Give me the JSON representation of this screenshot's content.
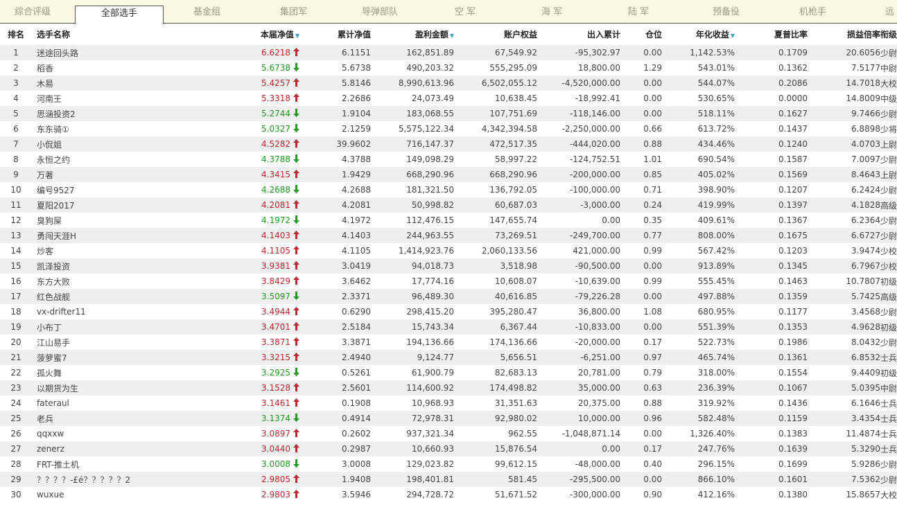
{
  "tabs": [
    {
      "label": "综合评级",
      "active": false
    },
    {
      "label": "全部选手",
      "active": true
    },
    {
      "label": "基金组",
      "active": false
    },
    {
      "label": "集团军",
      "active": false
    },
    {
      "label": "导弹部队",
      "active": false
    },
    {
      "label": "空  军",
      "active": false
    },
    {
      "label": "海  军",
      "active": false
    },
    {
      "label": "陆  军",
      "active": false
    },
    {
      "label": "预备役",
      "active": false
    },
    {
      "label": "机枪手",
      "active": false
    },
    {
      "label": "远",
      "active": false
    }
  ],
  "columns": [
    "排名",
    "选手名称",
    "本届净值",
    "累计净值",
    "盈利金额",
    "账户权益",
    "出入累计",
    "仓位",
    "年化收益",
    "夏普比率",
    "损益倍率",
    "衔级"
  ],
  "sort_icon": "▼",
  "colors": {
    "up": "#c0272d",
    "down": "#1e9a1e",
    "sort": "#3aa0c8"
  },
  "rows": [
    {
      "rank": "1",
      "name": "迷途回头路",
      "nav": "6.6218",
      "dir": "up",
      "cum": "6.1151",
      "profit": "162,851.89",
      "equity": "67,549.92",
      "flow": "-95,302.97",
      "pos": "0.00",
      "annual": "1,142.53%",
      "sharpe": "0.1709",
      "ratio": "20.6056",
      "grade": "少尉"
    },
    {
      "rank": "2",
      "name": "稻香",
      "nav": "5.6738",
      "dir": "down",
      "cum": "5.6738",
      "profit": "490,203.32",
      "equity": "555,295.09",
      "flow": "18,800.00",
      "pos": "1.29",
      "annual": "543.01%",
      "sharpe": "0.1362",
      "ratio": "7.5177",
      "grade": "中尉"
    },
    {
      "rank": "3",
      "name": "木易",
      "nav": "5.4257",
      "dir": "up",
      "cum": "5.8146",
      "profit": "8,990,613.96",
      "equity": "6,502,055.12",
      "flow": "-4,520,000.00",
      "pos": "0.00",
      "annual": "544.07%",
      "sharpe": "0.2086",
      "ratio": "14.7018",
      "grade": "大校"
    },
    {
      "rank": "4",
      "name": "河南王",
      "nav": "5.3318",
      "dir": "up",
      "cum": "2.2686",
      "profit": "24,073.49",
      "equity": "10,638.45",
      "flow": "-18,992.41",
      "pos": "0.00",
      "annual": "530.65%",
      "sharpe": "0.0000",
      "ratio": "14.8009",
      "grade": "中级士官"
    },
    {
      "rank": "5",
      "name": "思涵投资2",
      "nav": "5.2744",
      "dir": "down",
      "cum": "1.9104",
      "profit": "183,068.55",
      "equity": "107,751.69",
      "flow": "-118,146.00",
      "pos": "0.00",
      "annual": "518.11%",
      "sharpe": "0.1627",
      "ratio": "9.7466",
      "grade": "少尉"
    },
    {
      "rank": "6",
      "name": "东东骑①",
      "nav": "5.0327",
      "dir": "down",
      "cum": "2.1259",
      "profit": "5,575,122.34",
      "equity": "4,342,394.58",
      "flow": "-2,250,000.00",
      "pos": "0.66",
      "annual": "613.72%",
      "sharpe": "0.1437",
      "ratio": "6.8898",
      "grade": "少将"
    },
    {
      "rank": "7",
      "name": "小侃姐",
      "nav": "4.5282",
      "dir": "up",
      "cum": "39.9602",
      "profit": "716,147.37",
      "equity": "472,517.35",
      "flow": "-444,020.00",
      "pos": "0.88",
      "annual": "434.46%",
      "sharpe": "0.1240",
      "ratio": "4.0703",
      "grade": "上尉"
    },
    {
      "rank": "8",
      "name": "永恒之约",
      "nav": "4.3788",
      "dir": "down",
      "cum": "4.3788",
      "profit": "149,098.29",
      "equity": "58,997.22",
      "flow": "-124,752.51",
      "pos": "1.01",
      "annual": "690.54%",
      "sharpe": "0.1587",
      "ratio": "7.0097",
      "grade": "少尉"
    },
    {
      "rank": "9",
      "name": "万著",
      "nav": "4.3415",
      "dir": "up",
      "cum": "1.9429",
      "profit": "668,290.96",
      "equity": "668,290.96",
      "flow": "-200,000.00",
      "pos": "0.85",
      "annual": "405.02%",
      "sharpe": "0.1569",
      "ratio": "8.4643",
      "grade": "上尉"
    },
    {
      "rank": "10",
      "name": "编号9527",
      "nav": "4.2688",
      "dir": "down",
      "cum": "4.2688",
      "profit": "181,321.50",
      "equity": "136,792.05",
      "flow": "-100,000.00",
      "pos": "0.71",
      "annual": "398.90%",
      "sharpe": "0.1207",
      "ratio": "6.2424",
      "grade": "少尉"
    },
    {
      "rank": "11",
      "name": "夏阳2017",
      "nav": "4.2081",
      "dir": "up",
      "cum": "4.2081",
      "profit": "50,998.82",
      "equity": "60,687.03",
      "flow": "-3,000.00",
      "pos": "0.24",
      "annual": "419.99%",
      "sharpe": "0.1397",
      "ratio": "4.1828",
      "grade": "高级士官"
    },
    {
      "rank": "12",
      "name": "臭狗屎",
      "nav": "4.1972",
      "dir": "down",
      "cum": "4.1972",
      "profit": "112,476.15",
      "equity": "147,655.74",
      "flow": "0.00",
      "pos": "0.35",
      "annual": "409.61%",
      "sharpe": "0.1367",
      "ratio": "6.2364",
      "grade": "少尉"
    },
    {
      "rank": "13",
      "name": "勇闯天涯H",
      "nav": "4.1403",
      "dir": "up",
      "cum": "4.1403",
      "profit": "244,963.55",
      "equity": "73,269.51",
      "flow": "-249,700.00",
      "pos": "0.77",
      "annual": "808.00%",
      "sharpe": "0.1675",
      "ratio": "6.6727",
      "grade": "少尉"
    },
    {
      "rank": "14",
      "name": "炒客",
      "nav": "4.1105",
      "dir": "up",
      "cum": "4.1105",
      "profit": "1,414,923.76",
      "equity": "2,060,133.56",
      "flow": "421,000.00",
      "pos": "0.99",
      "annual": "567.42%",
      "sharpe": "0.1203",
      "ratio": "3.9474",
      "grade": "少校"
    },
    {
      "rank": "15",
      "name": "凯泽投资",
      "nav": "3.9381",
      "dir": "up",
      "cum": "3.0419",
      "profit": "94,018.73",
      "equity": "3,518.98",
      "flow": "-90,500.00",
      "pos": "0.00",
      "annual": "913.89%",
      "sharpe": "0.1345",
      "ratio": "6.7967",
      "grade": "少校"
    },
    {
      "rank": "16",
      "name": "东方大败",
      "nav": "3.8429",
      "dir": "up",
      "cum": "3.6462",
      "profit": "17,774.16",
      "equity": "10,608.07",
      "flow": "-10,639.00",
      "pos": "0.99",
      "annual": "555.45%",
      "sharpe": "0.1463",
      "ratio": "10.7807",
      "grade": "初级士官"
    },
    {
      "rank": "17",
      "name": "红色战舰",
      "nav": "3.5097",
      "dir": "down",
      "cum": "2.3371",
      "profit": "96,489.30",
      "equity": "40,616.85",
      "flow": "-79,226.28",
      "pos": "0.00",
      "annual": "497.88%",
      "sharpe": "0.1359",
      "ratio": "5.7425",
      "grade": "高级士官"
    },
    {
      "rank": "18",
      "name": "vx-drifter11",
      "nav": "3.4944",
      "dir": "up",
      "cum": "0.6290",
      "profit": "298,415.20",
      "equity": "395,280.47",
      "flow": "36,800.00",
      "pos": "1.08",
      "annual": "680.95%",
      "sharpe": "0.1177",
      "ratio": "3.4568",
      "grade": "少尉"
    },
    {
      "rank": "19",
      "name": "小布丁",
      "nav": "3.4701",
      "dir": "up",
      "cum": "2.5184",
      "profit": "15,743.34",
      "equity": "6,367.44",
      "flow": "-10,833.00",
      "pos": "0.00",
      "annual": "551.39%",
      "sharpe": "0.1353",
      "ratio": "4.9628",
      "grade": "初级士官"
    },
    {
      "rank": "20",
      "name": "江山易手",
      "nav": "3.3871",
      "dir": "up",
      "cum": "3.3871",
      "profit": "194,136.66",
      "equity": "174,136.66",
      "flow": "-20,000.00",
      "pos": "0.17",
      "annual": "522.73%",
      "sharpe": "0.1986",
      "ratio": "8.0432",
      "grade": "少尉"
    },
    {
      "rank": "21",
      "name": "菠萝蜜7",
      "nav": "3.3215",
      "dir": "up",
      "cum": "2.4940",
      "profit": "9,124.77",
      "equity": "5,656.51",
      "flow": "-6,251.00",
      "pos": "0.97",
      "annual": "465.74%",
      "sharpe": "0.1361",
      "ratio": "6.8532",
      "grade": "士兵"
    },
    {
      "rank": "22",
      "name": "孤火舞",
      "nav": "3.2925",
      "dir": "down",
      "cum": "0.5261",
      "profit": "61,900.79",
      "equity": "82,683.13",
      "flow": "20,781.00",
      "pos": "0.79",
      "annual": "318.00%",
      "sharpe": "0.1554",
      "ratio": "9.4409",
      "grade": "初级士官"
    },
    {
      "rank": "23",
      "name": "以期货为生",
      "nav": "3.1528",
      "dir": "up",
      "cum": "2.5601",
      "profit": "114,600.92",
      "equity": "174,498.82",
      "flow": "35,000.00",
      "pos": "0.63",
      "annual": "236.39%",
      "sharpe": "0.1067",
      "ratio": "5.0395",
      "grade": "中尉"
    },
    {
      "rank": "24",
      "name": "fateraul",
      "nav": "3.1461",
      "dir": "up",
      "cum": "0.1908",
      "profit": "10,968.93",
      "equity": "31,351.63",
      "flow": "20,375.00",
      "pos": "0.88",
      "annual": "319.92%",
      "sharpe": "0.1436",
      "ratio": "6.1646",
      "grade": "士兵"
    },
    {
      "rank": "25",
      "name": "老兵",
      "nav": "3.1374",
      "dir": "down",
      "cum": "0.4914",
      "profit": "72,978.31",
      "equity": "92,980.02",
      "flow": "10,000.00",
      "pos": "0.96",
      "annual": "582.48%",
      "sharpe": "0.1159",
      "ratio": "3.4354",
      "grade": "士兵"
    },
    {
      "rank": "26",
      "name": "qqxxw",
      "nav": "3.0897",
      "dir": "up",
      "cum": "0.2602",
      "profit": "937,321.34",
      "equity": "962.55",
      "flow": "-1,048,871.14",
      "pos": "0.00",
      "annual": "1,326.40%",
      "sharpe": "0.1383",
      "ratio": "11.4874",
      "grade": "士兵"
    },
    {
      "rank": "27",
      "name": "zenerz",
      "nav": "3.0440",
      "dir": "up",
      "cum": "0.2987",
      "profit": "10,660.93",
      "equity": "15,876.54",
      "flow": "0.00",
      "pos": "0.17",
      "annual": "247.76%",
      "sharpe": "0.1639",
      "ratio": "5.3290",
      "grade": "士兵"
    },
    {
      "rank": "28",
      "name": "FRT-推土机",
      "nav": "3.0008",
      "dir": "down",
      "cum": "3.0008",
      "profit": "129,023.82",
      "equity": "99,612.15",
      "flow": "-48,000.00",
      "pos": "0.40",
      "annual": "296.15%",
      "sharpe": "0.1699",
      "ratio": "5.9286",
      "grade": "少尉"
    },
    {
      "rank": "29",
      "name": "？？？？-£é？？？？？2",
      "nav": "2.9805",
      "dir": "up",
      "cum": "1.9408",
      "profit": "198,401.81",
      "equity": "581.45",
      "flow": "-295,500.00",
      "pos": "0.00",
      "annual": "866.10%",
      "sharpe": "0.1601",
      "ratio": "7.5362",
      "grade": "少尉"
    },
    {
      "rank": "30",
      "name": "wuxue",
      "nav": "2.9803",
      "dir": "up",
      "cum": "3.5946",
      "profit": "294,728.72",
      "equity": "51,671.52",
      "flow": "-300,000.00",
      "pos": "0.90",
      "annual": "412.16%",
      "sharpe": "0.1380",
      "ratio": "15.8657",
      "grade": "大校"
    }
  ]
}
